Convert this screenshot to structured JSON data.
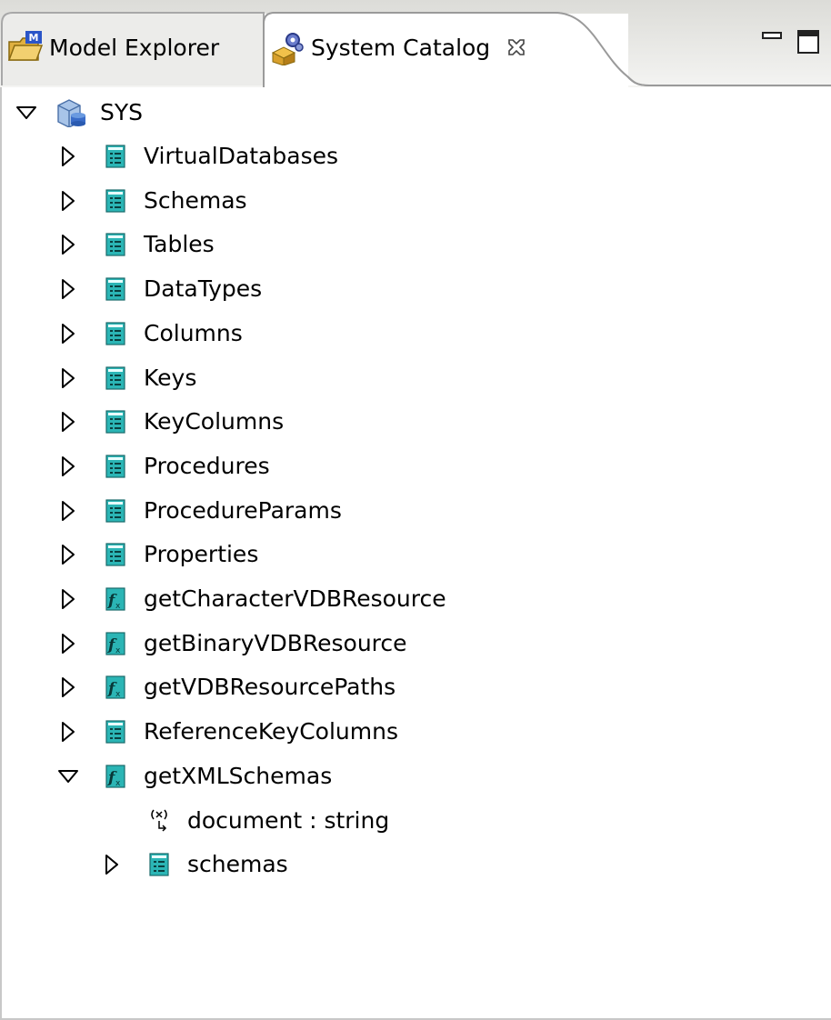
{
  "tabs": [
    {
      "label": "Model Explorer",
      "icon": "model-explorer-icon",
      "active": false
    },
    {
      "label": "System Catalog",
      "icon": "system-catalog-icon",
      "active": true
    }
  ],
  "window_controls": [
    "minimize-icon",
    "maximize-icon"
  ],
  "tree": {
    "root": {
      "label": "SYS",
      "icon": "database-icon",
      "expanded": true
    },
    "children": [
      {
        "label": "VirtualDatabases",
        "icon": "table-icon",
        "expanded": false
      },
      {
        "label": "Schemas",
        "icon": "table-icon",
        "expanded": false
      },
      {
        "label": "Tables",
        "icon": "table-icon",
        "expanded": false
      },
      {
        "label": "DataTypes",
        "icon": "table-icon",
        "expanded": false
      },
      {
        "label": "Columns",
        "icon": "table-icon",
        "expanded": false
      },
      {
        "label": "Keys",
        "icon": "table-icon",
        "expanded": false
      },
      {
        "label": "KeyColumns",
        "icon": "table-icon",
        "expanded": false
      },
      {
        "label": "Procedures",
        "icon": "table-icon",
        "expanded": false
      },
      {
        "label": "ProcedureParams",
        "icon": "table-icon",
        "expanded": false
      },
      {
        "label": "Properties",
        "icon": "table-icon",
        "expanded": false
      },
      {
        "label": "getCharacterVDBResource",
        "icon": "procedure-icon",
        "expanded": false
      },
      {
        "label": "getBinaryVDBResource",
        "icon": "procedure-icon",
        "expanded": false
      },
      {
        "label": "getVDBResourcePaths",
        "icon": "procedure-icon",
        "expanded": false
      },
      {
        "label": "ReferenceKeyColumns",
        "icon": "table-icon",
        "expanded": false
      },
      {
        "label": "getXMLSchemas",
        "icon": "procedure-icon",
        "expanded": true,
        "children": [
          {
            "label": "document : string",
            "icon": "parameter-icon"
          },
          {
            "label": "schemas",
            "icon": "table-icon",
            "expanded": false
          }
        ]
      }
    ]
  },
  "colors": {
    "table_icon": "#2bb5b5",
    "procedure_icon": "#2bb5b5",
    "tab_border": "#9a9a9a",
    "header_bg": "#e9e9e6"
  }
}
